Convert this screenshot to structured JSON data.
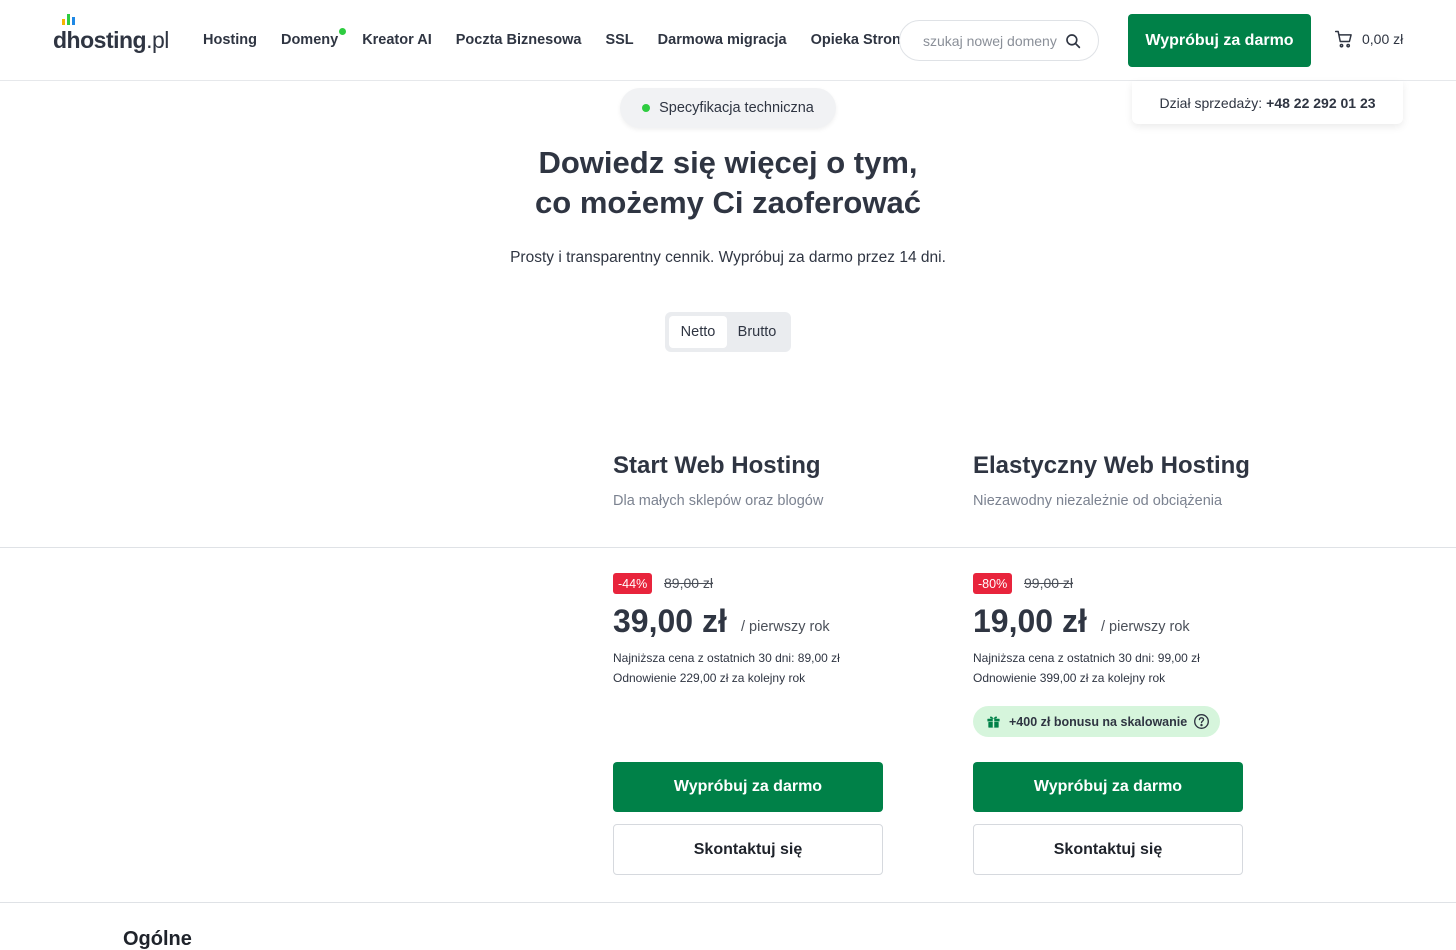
{
  "header": {
    "logo_text": "dhosting",
    "logo_tld": ".pl",
    "nav": [
      {
        "label": "Hosting"
      },
      {
        "label": "Domeny",
        "dot": true
      },
      {
        "label": "Kreator AI"
      },
      {
        "label": "Poczta Biznesowa"
      },
      {
        "label": "SSL"
      },
      {
        "label": "Darmowa migracja"
      },
      {
        "label": "Opieka Stron"
      }
    ],
    "search_placeholder": "szukaj nowej domeny",
    "search_icon": "search-icon",
    "cta_label": "Wypróbuj za darmo",
    "cart_total": "0,00 zł",
    "cart_icon": "cart-icon"
  },
  "sales": {
    "label": "Dział sprzedaży:",
    "phone": "+48 22 292 01 23"
  },
  "hero": {
    "pill_label": "Specyfikacja techniczna",
    "title_line1": "Dowiedz się więcej o tym,",
    "title_line2": "co możemy Ci zaoferować",
    "subtitle": "Prosty i transparentny cennik. Wypróbuj za darmo przez 14 dni.",
    "toggle_netto": "Netto",
    "toggle_brutto": "Brutto",
    "toggle_selected": "Netto"
  },
  "plans": [
    {
      "name": "Start Web Hosting",
      "tagline": "Dla małych sklepów oraz blogów",
      "discount": "-44%",
      "old_price": "89,00 zł",
      "price": "39,00 zł",
      "period": "/ pierwszy rok",
      "lowest_price": "Najniższa cena z ostatnich 30 dni: 89,00 zł",
      "renewal": "Odnowienie 229,00 zł za kolejny rok",
      "try_label": "Wypróbuj za darmo",
      "contact_label": "Skontaktuj się"
    },
    {
      "name": "Elastyczny Web Hosting",
      "tagline": "Niezawodny niezależnie od obciążenia",
      "discount": "-80%",
      "old_price": "99,00 zł",
      "price": "19,00 zł",
      "period": "/ pierwszy rok",
      "lowest_price": "Najniższa cena z ostatnich 30 dni: 99,00 zł",
      "renewal": "Odnowienie 399,00 zł za kolejny rok",
      "bonus": "+400 zł bonusu na skalowanie",
      "try_label": "Wypróbuj za darmo",
      "contact_label": "Skontaktuj się"
    }
  ],
  "colors": {
    "brand_green": "#008148",
    "discount_red": "#e8243c",
    "bonus_bg": "#d6f5dc",
    "dot_green": "#2ecc40"
  },
  "section": {
    "title": "Ogólne"
  }
}
